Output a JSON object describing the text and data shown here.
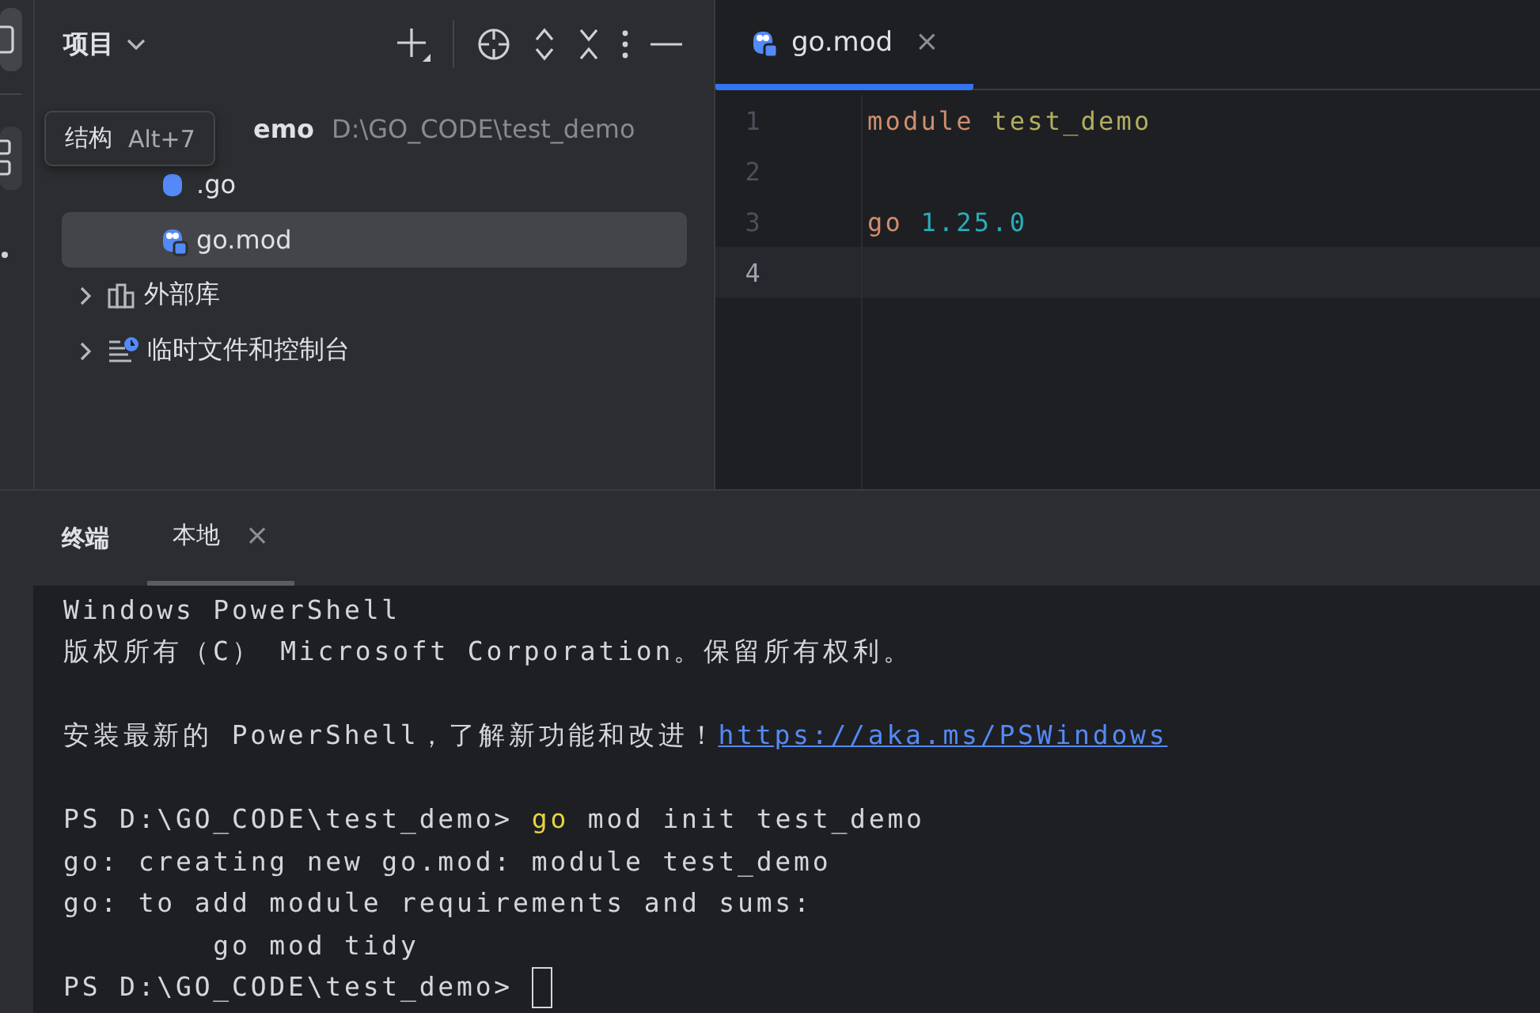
{
  "project_panel": {
    "title": "项目",
    "tree": [
      {
        "name": "emo",
        "path": "D:\\GO_CODE\\test_demo",
        "kind": "folder",
        "children": [
          {
            "name": ".go",
            "kind": "gofile",
            "selected": false
          },
          {
            "name": "go.mod",
            "kind": "gomod",
            "selected": true
          }
        ]
      },
      {
        "name": "外部库",
        "kind": "library",
        "expanded": false
      },
      {
        "name": "临时文件和控制台",
        "kind": "scratch",
        "expanded": false
      }
    ]
  },
  "tooltip": {
    "label": "结构",
    "shortcut": "Alt+7"
  },
  "editor": {
    "tabs": [
      {
        "label": "go.mod",
        "close": "×",
        "selected": true
      }
    ],
    "lines": [
      {
        "number": "1",
        "current": false,
        "tokens": [
          {
            "text": "module",
            "kind": "keyword"
          },
          {
            "text": " test_demo",
            "kind": "string"
          }
        ]
      },
      {
        "number": "2",
        "current": false
      },
      {
        "number": "3",
        "current": false,
        "tokens": [
          {
            "text": "go",
            "kind": "keyword"
          },
          {
            "text": " 1.25.0",
            "kind": "number"
          }
        ]
      },
      {
        "number": "4",
        "current": true
      }
    ]
  },
  "terminal": {
    "title": "终端",
    "tabs": [
      {
        "label": "本地",
        "close": "×",
        "selected": true
      }
    ],
    "lines": [
      {
        "segments": [
          {
            "text": "Windows PowerShell",
            "kind": "plain"
          }
        ]
      },
      {
        "segments": [
          {
            "text": "版权所有（C） Microsoft Corporation。保留所有权利。",
            "kind": "plain"
          }
        ]
      },
      {
        "gap_before": true,
        "segments": [
          {
            "text": "安装最新的 PowerShell，了解新功能和改进！",
            "kind": "plain"
          },
          {
            "text": "https://aka.ms/PSWindows",
            "kind": "link"
          }
        ]
      },
      {
        "gap_before": true,
        "segments": [
          {
            "text": "PS D:\\GO_CODE\\test_demo> ",
            "kind": "plain"
          },
          {
            "text": "go",
            "kind": "command"
          },
          {
            "text": " mod init test_demo",
            "kind": "plain"
          }
        ]
      },
      {
        "segments": [
          {
            "text": "go: creating new go.mod: module test_demo",
            "kind": "plain"
          }
        ]
      },
      {
        "segments": [
          {
            "text": "go: to add module requirements and sums:",
            "kind": "plain"
          }
        ]
      },
      {
        "segments": [
          {
            "text": "        go mod tidy",
            "kind": "plain"
          }
        ]
      },
      {
        "segments": [
          {
            "text": "PS D:\\GO_CODE\\test_demo> ",
            "kind": "plain"
          },
          {
            "kind": "cursor"
          }
        ]
      }
    ]
  }
}
